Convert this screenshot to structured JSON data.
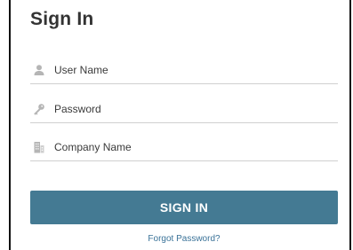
{
  "form": {
    "title": "Sign In",
    "fields": [
      {
        "icon": "user-icon",
        "placeholder": "User Name",
        "value": ""
      },
      {
        "icon": "key-icon",
        "placeholder": "Password",
        "value": ""
      },
      {
        "icon": "building-icon",
        "placeholder": "Company Name",
        "value": ""
      }
    ],
    "submit_label": "SIGN IN",
    "forgot_label": "Forgot Password?"
  },
  "colors": {
    "button": "#447a93",
    "link": "#3a7298",
    "icon": "#b5b5b5"
  }
}
